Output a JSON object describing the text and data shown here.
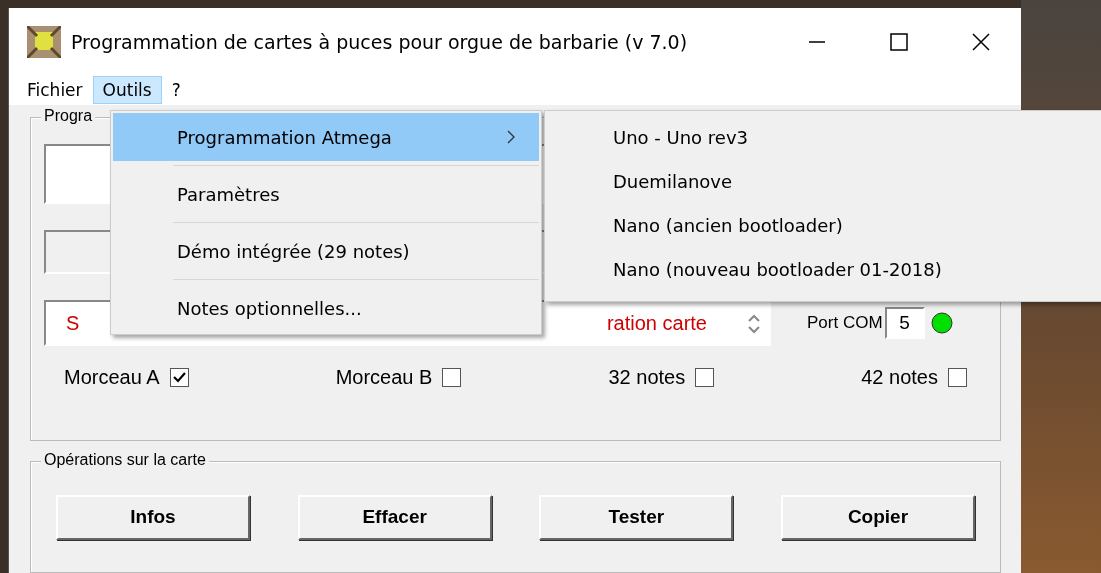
{
  "window": {
    "title": "Programmation de cartes à puces pour orgue de barbarie (v 7.0)"
  },
  "menubar": [
    {
      "label": "Fichier",
      "selected": false
    },
    {
      "label": "Outils",
      "selected": true
    },
    {
      "label": "?",
      "selected": false
    }
  ],
  "menu": [
    {
      "label": "Programmation Atmega",
      "selected": true,
      "kind": "submenu"
    },
    {
      "label": "Paramètres",
      "selected": false,
      "kind": "item"
    },
    {
      "label": "Démo intégrée (29 notes)",
      "selected": false,
      "kind": "item"
    },
    {
      "label": "Notes optionnelles...",
      "selected": false,
      "kind": "item"
    }
  ],
  "submenu": [
    {
      "label": "Uno - Uno rev3"
    },
    {
      "label": "Duemilanove"
    },
    {
      "label": "Nano (ancien bootloader)"
    },
    {
      "label": "Nano (nouveau bootloader 01-2018)"
    }
  ],
  "program_group": {
    "title": "Progra",
    "status_start": "S",
    "status_end": "ration carte",
    "port_label": "Port COM",
    "port_value": "5",
    "port_connected": true,
    "options": [
      {
        "label": "Morceau A",
        "checked": true
      },
      {
        "label": "Morceau B",
        "checked": false
      },
      {
        "label": "32 notes",
        "checked": false
      },
      {
        "label": "42 notes",
        "checked": false
      }
    ]
  },
  "operations_group": {
    "title": "Opérations sur la carte",
    "buttons": [
      "Infos",
      "Effacer",
      "Tester",
      "Copier"
    ]
  }
}
